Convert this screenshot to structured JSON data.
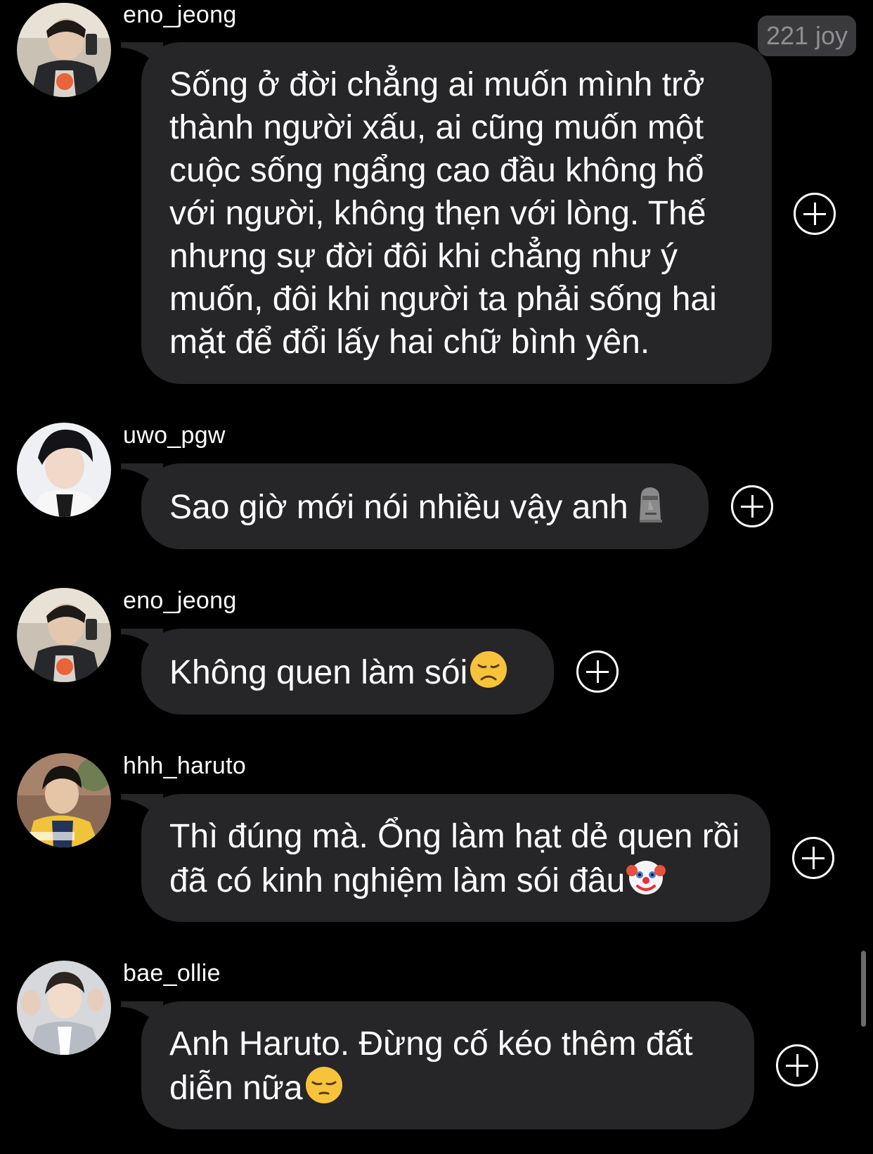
{
  "badge": {
    "text": "221 joy"
  },
  "messages": [
    {
      "username": "eno_jeong",
      "text": "Sống ở đời chẳng ai muốn mình trở thành người xấu, ai cũng muốn một cuộc sống ngẩng cao đầu không hổ với người, không thẹn với lòng. Thế nhưng sự đời đôi khi chẳng như ý muốn, đôi khi người ta phải sống hai mặt để đổi lấy hai chữ bình yên.",
      "emoji": ""
    },
    {
      "username": "uwo_pgw",
      "text": "Sao giờ mới nói nhiều vậy anh",
      "emoji": "moai-emoji"
    },
    {
      "username": "eno_jeong",
      "text": "Không quen làm sói",
      "emoji": "disappointed-face-emoji"
    },
    {
      "username": "hhh_haruto",
      "text": "Thì đúng mà. Ổng làm hạt dẻ quen rồi đã có kinh nghiệm làm sói đâu",
      "emoji": "clown-face-emoji"
    },
    {
      "username": "bae_ollie",
      "text": "Anh Haruto. Đừng cố kéo thêm đất diễn nữa",
      "emoji": "pensive-face-emoji"
    }
  ],
  "colors": {
    "background": "#000000",
    "bubble": "#262628",
    "badge_bg": "#3a3a3c",
    "badge_text": "#8e8e93",
    "text": "#ffffff"
  },
  "icons": {
    "add_reaction": "plus-circle-icon"
  }
}
